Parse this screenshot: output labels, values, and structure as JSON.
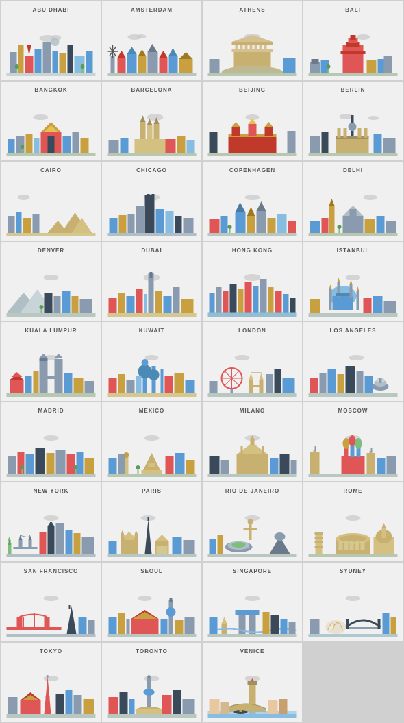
{
  "cities": [
    {
      "name": "ABU DHABI"
    },
    {
      "name": "AMSTERDAM"
    },
    {
      "name": "ATHENS"
    },
    {
      "name": "BALI"
    },
    {
      "name": "BANGKOK"
    },
    {
      "name": "BARCELONA"
    },
    {
      "name": "BEIJING"
    },
    {
      "name": "BERLIN"
    },
    {
      "name": "CAIRO"
    },
    {
      "name": "CHICAGO"
    },
    {
      "name": "COPENHAGEN"
    },
    {
      "name": "DELHI"
    },
    {
      "name": "DENVER"
    },
    {
      "name": "DUBAI"
    },
    {
      "name": "HONG KONG"
    },
    {
      "name": "ISTANBUL"
    },
    {
      "name": "KUALA LUMPUR"
    },
    {
      "name": "KUWAIT"
    },
    {
      "name": "LONDON"
    },
    {
      "name": "LOS ANGELES"
    },
    {
      "name": "MADRID"
    },
    {
      "name": "MEXICO"
    },
    {
      "name": "MILANO"
    },
    {
      "name": "MOSCOW"
    },
    {
      "name": "NEW YORK"
    },
    {
      "name": "PARIS"
    },
    {
      "name": "RIO DE JANEIRO"
    },
    {
      "name": "ROME"
    },
    {
      "name": "SAN FRANCISCO"
    },
    {
      "name": "SEOUL"
    },
    {
      "name": "SINGAPORE"
    },
    {
      "name": "SYDNEY"
    },
    {
      "name": "TOKYO"
    },
    {
      "name": "TORONTO"
    },
    {
      "name": "VENICE"
    }
  ]
}
